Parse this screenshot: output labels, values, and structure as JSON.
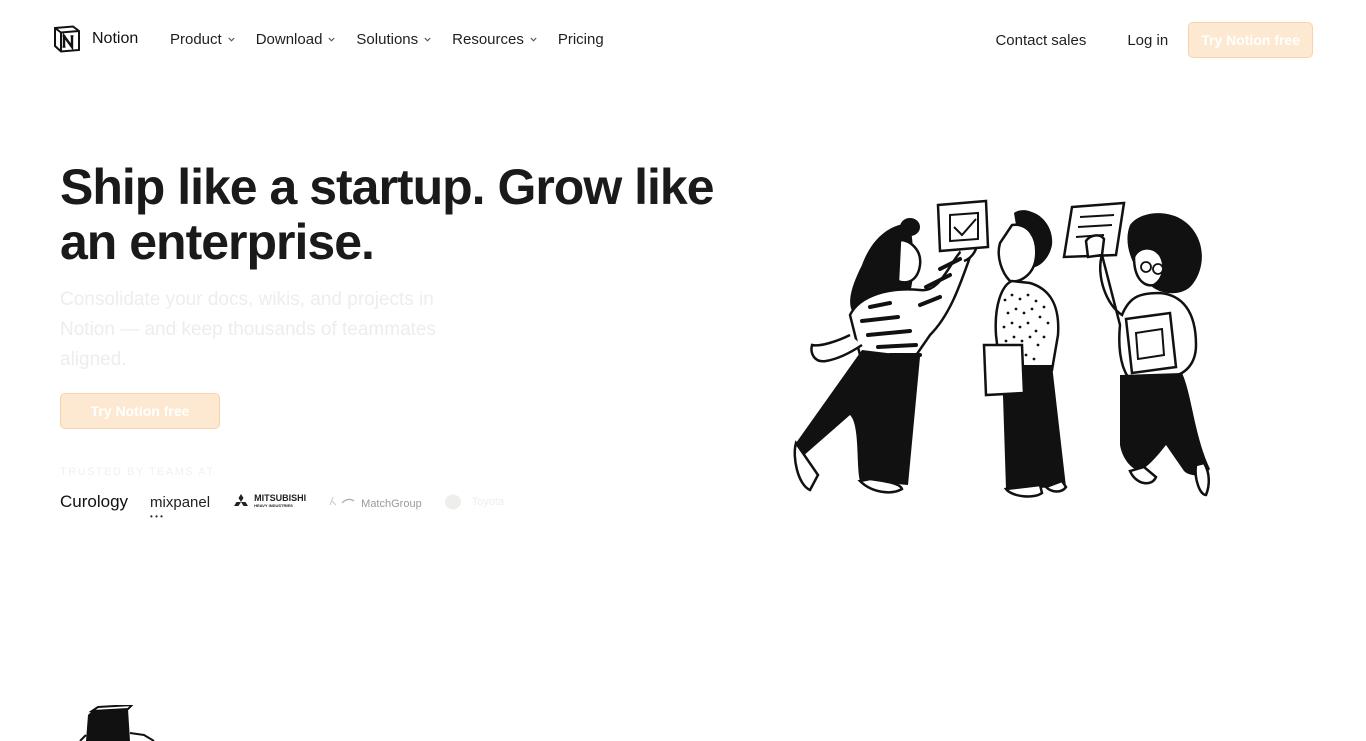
{
  "nav": {
    "brand": "Notion",
    "menu": [
      {
        "label": "Product",
        "has_dropdown": true
      },
      {
        "label": "Download",
        "has_dropdown": true
      },
      {
        "label": "Solutions",
        "has_dropdown": true
      },
      {
        "label": "Resources",
        "has_dropdown": true
      },
      {
        "label": "Pricing",
        "has_dropdown": false
      }
    ],
    "contact_sales": "Contact sales",
    "login": "Log in",
    "try_free": "Try Notion free"
  },
  "hero": {
    "title_line1": "Ship like a startup. Grow like",
    "title_line2": "an enterprise.",
    "subtitle": "Consolidate your docs, wikis, and projects in Notion — and keep thousands of teammates aligned.",
    "cta": "Try Notion free",
    "trusted_label": "TRUSTED BY TEAMS AT"
  },
  "logos": {
    "curology": "Curology",
    "mixpanel": "mixpanel",
    "mixpanel_dots": "• • •",
    "mitsubishi": "MITSUBISHI",
    "mitsubishi_sub": "HEAVY INDUSTRIES",
    "match": "MatchGroup",
    "faded": "Toyota"
  },
  "colors": {
    "accent_bg": "#fde9d1",
    "accent_border": "#f8d3ad",
    "text": "#1a1a1a"
  },
  "icons": {
    "logo": "notion-logo-icon",
    "chevron": "chevron-down-icon"
  }
}
